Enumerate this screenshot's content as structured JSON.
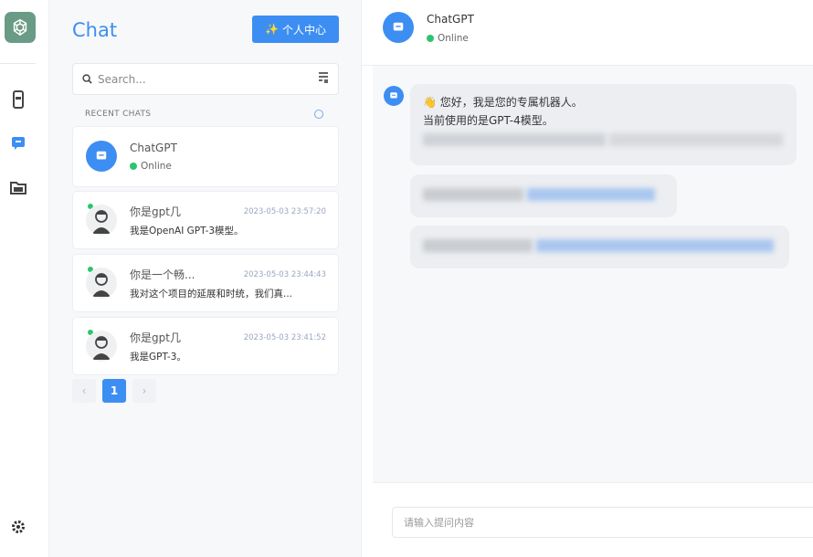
{
  "app": {
    "accent": "#3d8ef2",
    "online_color": "#2cc56f"
  },
  "sidebar": {
    "title": "Chat",
    "center_button_label": "个人中心",
    "center_button_emoji": "✨",
    "search_placeholder": "Search...",
    "recent_label": "RECENT CHATS"
  },
  "pinned": {
    "name": "ChatGPT",
    "status": "Online"
  },
  "conversations": [
    {
      "name": "你是gpt几",
      "time": "2023-05-03 23:57:20",
      "preview": "我是OpenAI GPT-3模型。"
    },
    {
      "name": "你是一个畅...",
      "time": "2023-05-03 23:44:43",
      "preview": "我对这个项目的延展和时统，我们真..."
    },
    {
      "name": "你是gpt几",
      "time": "2023-05-03 23:41:52",
      "preview": "我是GPT-3。"
    }
  ],
  "pagination": {
    "prev": "‹",
    "current": "1",
    "next": "›"
  },
  "chat": {
    "name": "ChatGPT",
    "status": "Online",
    "greeting_emoji": "👋",
    "greeting": "您好，我是您的专属机器人。",
    "model_line": "当前使用的是GPT-4模型。"
  },
  "composer": {
    "placeholder": "请输入提问内容"
  }
}
